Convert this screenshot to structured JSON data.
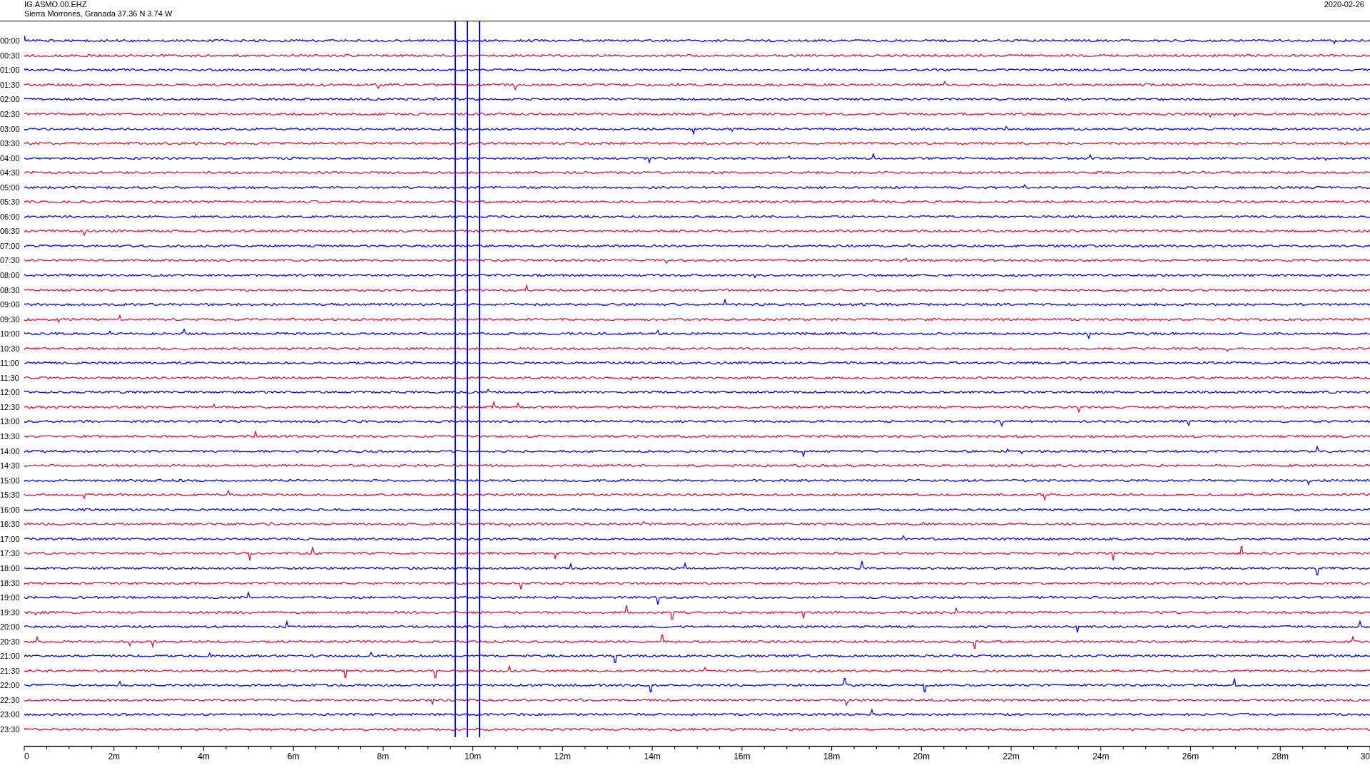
{
  "header": {
    "station": "IG.ASMO.00.EHZ",
    "location": "Sierra Morrones, Granada  37.36 N 3.74 W",
    "date": "2020-02-26"
  },
  "traces": [
    {
      "label": "00:00",
      "color": "#0000ff"
    },
    {
      "label": "00:30",
      "color": "#dc143c"
    },
    {
      "label": "01:00",
      "color": "#0000ff"
    },
    {
      "label": "01:30",
      "color": "#dc143c"
    },
    {
      "label": "02:00",
      "color": "#0000ff"
    },
    {
      "label": "02:30",
      "color": "#dc143c"
    },
    {
      "label": "03:00",
      "color": "#0000ff"
    },
    {
      "label": "03:30",
      "color": "#dc143c"
    },
    {
      "label": "04:00",
      "color": "#0000ff"
    },
    {
      "label": "04:30",
      "color": "#dc143c"
    },
    {
      "label": "05:00",
      "color": "#0000ff"
    },
    {
      "label": "05:30",
      "color": "#dc143c"
    },
    {
      "label": "06:00",
      "color": "#0000ff"
    },
    {
      "label": "06:30",
      "color": "#dc143c"
    },
    {
      "label": "07:00",
      "color": "#0000ff"
    },
    {
      "label": "07:30",
      "color": "#dc143c"
    },
    {
      "label": "08:00",
      "color": "#0000ff"
    },
    {
      "label": "08:30",
      "color": "#dc143c"
    },
    {
      "label": "09:00",
      "color": "#0000ff"
    },
    {
      "label": "09:30",
      "color": "#dc143c"
    },
    {
      "label": "10:00",
      "color": "#0000ff"
    },
    {
      "label": "10:30",
      "color": "#dc143c"
    },
    {
      "label": "11:00",
      "color": "#0000ff"
    },
    {
      "label": "11:30",
      "color": "#dc143c"
    },
    {
      "label": "12:00",
      "color": "#0000ff"
    },
    {
      "label": "12:30",
      "color": "#dc143c"
    },
    {
      "label": "13:00",
      "color": "#0000ff"
    },
    {
      "label": "13:30",
      "color": "#dc143c"
    },
    {
      "label": "14:00",
      "color": "#0000ff"
    },
    {
      "label": "14:30",
      "color": "#dc143c"
    },
    {
      "label": "15:00",
      "color": "#0000ff"
    },
    {
      "label": "15:30",
      "color": "#dc143c"
    },
    {
      "label": "16:00",
      "color": "#0000ff"
    },
    {
      "label": "16:30",
      "color": "#dc143c"
    },
    {
      "label": "17:00",
      "color": "#0000ff"
    },
    {
      "label": "17:30",
      "color": "#dc143c"
    },
    {
      "label": "18:00",
      "color": "#0000ff"
    },
    {
      "label": "18:30",
      "color": "#dc143c"
    },
    {
      "label": "19:00",
      "color": "#0000ff"
    },
    {
      "label": "19:30",
      "color": "#dc143c"
    },
    {
      "label": "20:00",
      "color": "#0000ff"
    },
    {
      "label": "20:30",
      "color": "#dc143c"
    },
    {
      "label": "21:00",
      "color": "#0000ff"
    },
    {
      "label": "21:30",
      "color": "#dc143c"
    },
    {
      "label": "22:00",
      "color": "#0000ff"
    },
    {
      "label": "22:30",
      "color": "#dc143c"
    },
    {
      "label": "23:00",
      "color": "#0000ff"
    },
    {
      "label": "23:30",
      "color": "#dc143c"
    }
  ],
  "x_axis": {
    "labels": [
      "0",
      "2m",
      "4m",
      "6m",
      "8m",
      "10m",
      "12m",
      "14m",
      "16m",
      "18m",
      "20m",
      "22m",
      "24m",
      "26m",
      "28m",
      "30"
    ]
  }
}
